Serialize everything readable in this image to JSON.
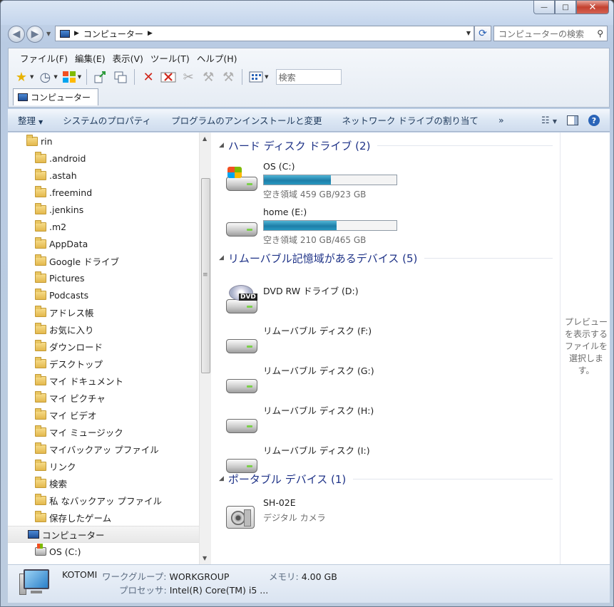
{
  "window": {
    "caption_min": "—",
    "caption_max": "□",
    "caption_close": "✕"
  },
  "address": {
    "path_item": "コンピューター",
    "search_placeholder": "コンピューターの検索"
  },
  "menu": [
    "ファイル(F)",
    "編集(E)",
    "表示(V)",
    "ツール(T)",
    "ヘルプ(H)"
  ],
  "toolbar": {
    "icons": [
      "favorites-star",
      "history-clock",
      "windows-logo",
      "move-up",
      "copy-folder",
      "delete-x",
      "delete-x-box",
      "cut-disabled",
      "copy-disabled",
      "paste-disabled",
      "view-grid"
    ],
    "search_placeholder": "検索",
    "tab_label": "コンピューター"
  },
  "commandbar": {
    "organize": "整理",
    "system_properties": "システムのプロパティ",
    "uninstall": "プログラムのアンインストールと変更",
    "map_drive": "ネットワーク ドライブの割り当て",
    "more": "»"
  },
  "navpane": {
    "items": [
      {
        "label": "rin",
        "icon": "user-folder"
      },
      {
        "label": ".android",
        "icon": "folder"
      },
      {
        "label": ".astah",
        "icon": "folder"
      },
      {
        "label": ".freemind",
        "icon": "folder"
      },
      {
        "label": ".jenkins",
        "icon": "folder"
      },
      {
        "label": ".m2",
        "icon": "folder"
      },
      {
        "label": "AppData",
        "icon": "folder"
      },
      {
        "label": "Google ドライブ",
        "icon": "google-drive-folder"
      },
      {
        "label": "Pictures",
        "icon": "folder"
      },
      {
        "label": "Podcasts",
        "icon": "folder"
      },
      {
        "label": "アドレス帳",
        "icon": "contacts-folder"
      },
      {
        "label": "お気に入り",
        "icon": "favorites-folder"
      },
      {
        "label": "ダウンロード",
        "icon": "downloads-folder"
      },
      {
        "label": "デスクトップ",
        "icon": "desktop-folder"
      },
      {
        "label": "マイ ドキュメント",
        "icon": "documents-folder"
      },
      {
        "label": "マイ ピクチャ",
        "icon": "pictures-folder"
      },
      {
        "label": "マイ ビデオ",
        "icon": "videos-folder"
      },
      {
        "label": "マイ ミュージック",
        "icon": "music-folder"
      },
      {
        "label": "マイバックアッ プファイル",
        "icon": "folder"
      },
      {
        "label": "リンク",
        "icon": "links-folder"
      },
      {
        "label": "検索",
        "icon": "searches-folder"
      },
      {
        "label": "私 なバックアッ プファイル",
        "icon": "folder"
      },
      {
        "label": "保存したゲーム",
        "icon": "saved-games-folder"
      },
      {
        "label": "コンピューター",
        "icon": "computer"
      },
      {
        "label": "OS (C:)",
        "icon": "windows-drive"
      }
    ]
  },
  "groups": {
    "hdd": "ハード ディスク ドライブ (2)",
    "removable": "リムーバブル記憶域があるデバイス (5)",
    "portable": "ポータブル デバイス (1)"
  },
  "drives": {
    "c": {
      "name": "OS (C:)",
      "free": "空き領域 459 GB/923 GB",
      "used_fraction": 0.503
    },
    "e": {
      "name": "home (E:)",
      "free": "空き領域 210 GB/465 GB",
      "used_fraction": 0.548
    },
    "d": {
      "name": "DVD RW ドライブ (D:)",
      "badge": "DVD"
    },
    "f": {
      "name": "リムーバブル ディスク (F:)"
    },
    "g": {
      "name": "リムーバブル ディスク (G:)"
    },
    "h": {
      "name": "リムーバブル ディスク (H:)"
    },
    "i": {
      "name": "リムーバブル ディスク (I:)"
    },
    "sh": {
      "name": "SH-02E",
      "sub": "デジタル カメラ"
    }
  },
  "preview": {
    "text": "プレビューを表示するファイルを選択しま す。"
  },
  "details": {
    "computer_name": "KOTOMI",
    "workgroup_label": "ワークグループ:",
    "workgroup_value": "WORKGROUP",
    "memory_label": "メモリ:",
    "memory_value": "4.00 GB",
    "processor_label": "プロセッサ:",
    "processor_value": "Intel(R) Core(TM) i5 ..."
  }
}
